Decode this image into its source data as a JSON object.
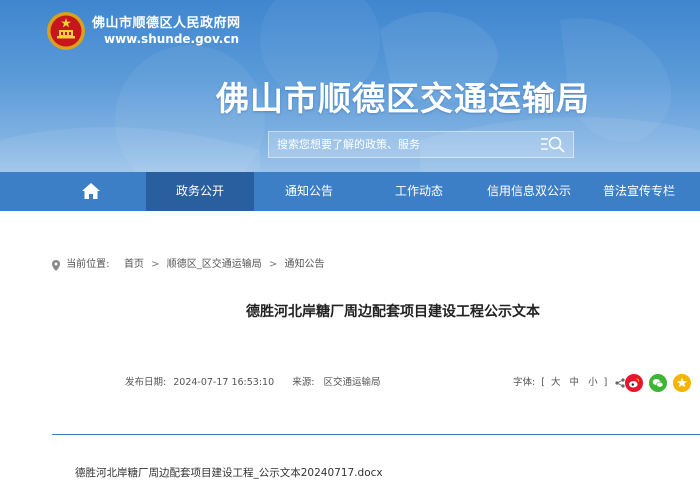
{
  "header": {
    "site_name": "佛山市顺德区人民政府网",
    "site_url": "www.shunde.gov.cn",
    "bureau_title": "佛山市顺德区交通运输局",
    "search_placeholder": "搜索您想要了解的政策、服务",
    "emblem_icon": "national-emblem-icon",
    "search_icon": "search-icon"
  },
  "nav": {
    "home_icon": "home-icon",
    "items": [
      {
        "label": "政务公开",
        "active": true
      },
      {
        "label": "通知公告",
        "active": false
      },
      {
        "label": "工作动态",
        "active": false
      },
      {
        "label": "信用信息双公示",
        "active": false
      },
      {
        "label": "普法宣传专栏",
        "active": false
      }
    ]
  },
  "breadcrumb": {
    "prefix": "当前位置:",
    "items": [
      "首页",
      "顺德区_区交通运输局",
      "通知公告"
    ],
    "separator": ">"
  },
  "article": {
    "title": "德胜河北岸糖厂周边配套项目建设工程公示文本",
    "publish_label": "发布日期:",
    "publish_date": "2024-07-17 16:53:10",
    "source_label": "来源:",
    "source": "区交通运输局",
    "font_label": "字体:",
    "font_open": "[",
    "font_large": "大",
    "font_medium": "中",
    "font_small": "小",
    "font_close": "]",
    "attachment": "德胜河北岸糖厂周边配套项目建设工程_公示文本20240717.docx"
  },
  "share": {
    "icons": [
      "share-icon",
      "weibo-icon",
      "wechat-icon",
      "qzone-icon"
    ]
  },
  "colors": {
    "nav_bg": "#3d7fc6",
    "nav_active": "#2a5f9f",
    "divider": "#3d7fc6",
    "weibo": "#e6162d",
    "wechat": "#3fb535",
    "qzone": "#f5b400"
  }
}
